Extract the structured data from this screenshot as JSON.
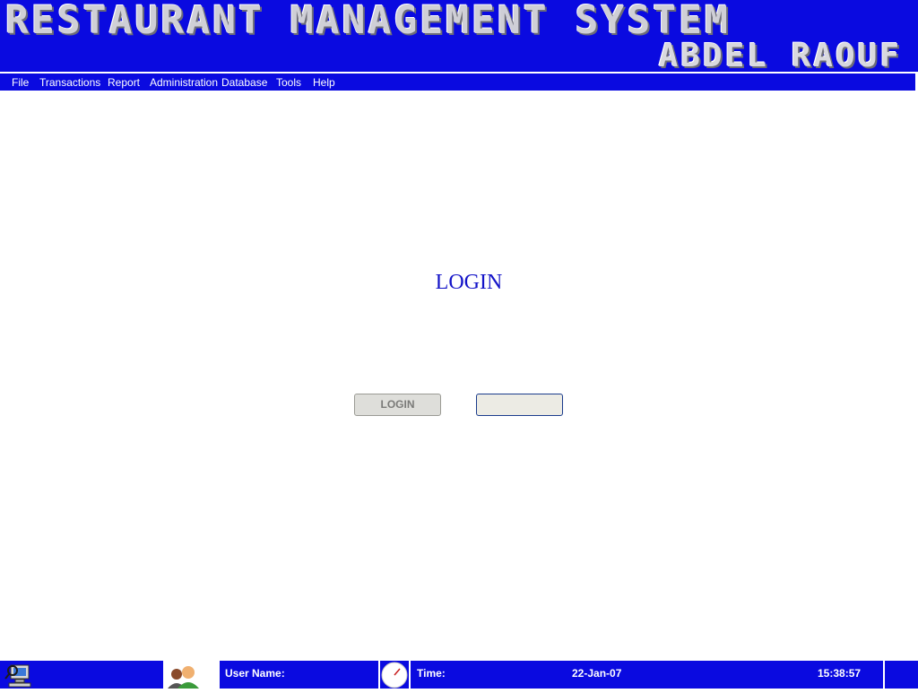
{
  "banner": {
    "title": "RESTAURANT MANAGEMENT SYSTEM",
    "subtitle": "ABDEL RAOUF"
  },
  "menu": {
    "items": [
      "File",
      "Transactions",
      "Report",
      "Administration",
      "Database",
      "Tools",
      "Help"
    ]
  },
  "login": {
    "heading": "LOGIN",
    "login_button": "LOGIN",
    "second_button": ""
  },
  "status": {
    "user_label": "User Name:",
    "user_value": "",
    "time_label": "Time:",
    "date": "22-Jan-07",
    "clock": "15:38:57"
  },
  "icons": {
    "computer": "computer-search-icon",
    "users": "users-icon",
    "clock": "clock-icon"
  },
  "colors": {
    "banner_bg": "#0a0ae0",
    "heading": "#1414c8",
    "page_bg": "#ffffff"
  }
}
